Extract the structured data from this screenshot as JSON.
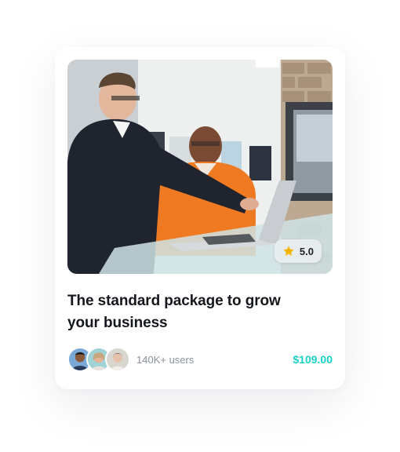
{
  "card": {
    "image_alt": "Two men looking at a laptop in an office",
    "rating": "5.0",
    "title": "The standard package to grow your business",
    "users_label": "140K+ users",
    "price": "$109.00",
    "avatars": [
      "user-avatar-1",
      "user-avatar-2",
      "user-avatar-3"
    ]
  },
  "colors": {
    "price": "#19d3c5",
    "star": "#f5b400",
    "title": "#14171c",
    "muted": "#8b9099"
  },
  "icons": {
    "rating": "star-icon"
  }
}
